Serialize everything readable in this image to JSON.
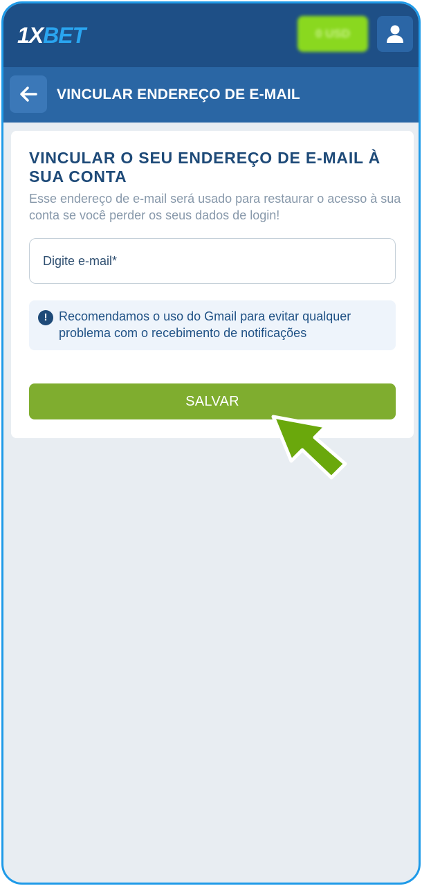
{
  "header": {
    "logo_prefix": "1X",
    "logo_suffix": "BET",
    "balance_label": "0 USD",
    "profile_icon": "user-icon"
  },
  "subheader": {
    "back_icon": "arrow-left-icon",
    "title": "VINCULAR ENDEREÇO DE E-MAIL"
  },
  "form": {
    "title": "VINCULAR O SEU ENDEREÇO DE E-MAIL À SUA CONTA",
    "description": "Esse endereço de e-mail será usado para restaurar o acesso à sua conta se você perder os seus dados de login!",
    "email_placeholder": "Digite e-mail*",
    "email_value": "",
    "notice_icon": "exclamation-circle-icon",
    "notice_text": "Recomendamos o uso do Gmail para evitar qualquer problema com o recebimento de notificações",
    "save_label": "SALVAR"
  },
  "colors": {
    "header_bg": "#1e4f86",
    "subheader_bg": "#2a66a4",
    "accent_green": "#7fad2f",
    "pointer_green": "#6aa80c",
    "frame_border": "#1e9ae8"
  },
  "overlay": {
    "pointer_icon": "cursor-arrow-icon"
  }
}
